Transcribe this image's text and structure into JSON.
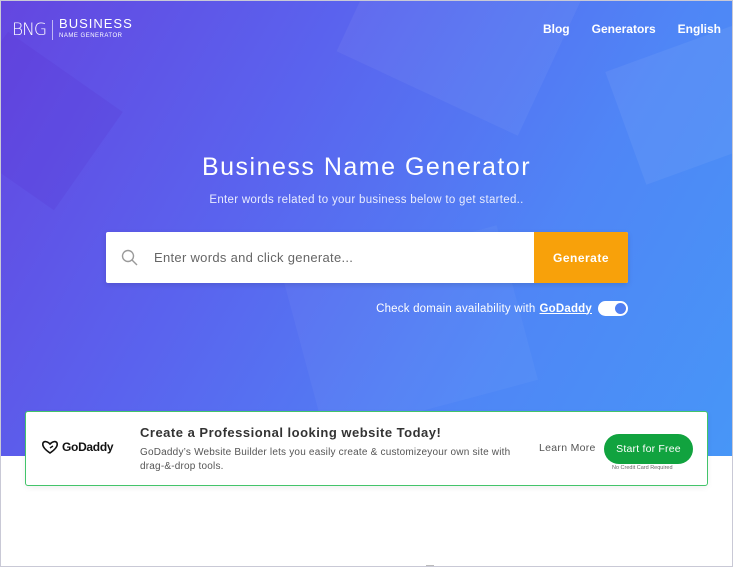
{
  "logo": {
    "mark": "BNG",
    "line1": "BUSINESS",
    "line2": "NAME GENERATOR"
  },
  "nav": {
    "blog": "Blog",
    "generators": "Generators",
    "language": "English"
  },
  "hero": {
    "title": "Business Name Generator",
    "subtitle": "Enter words related to your business below to get started.."
  },
  "search": {
    "placeholder": "Enter words and click generate...",
    "value": "",
    "button": "Generate"
  },
  "domain_check": {
    "text": "Check domain availability with",
    "link": "GoDaddy",
    "enabled": true
  },
  "ad": {
    "brand": "GoDaddy",
    "title": "Create a Professional looking website Today!",
    "description": "GoDaddy’s Website Builder lets you easily create & customizeyour own site with drag-&-drop tools.",
    "learn_more": "Learn More",
    "cta": "Start for Free",
    "note": "No Credit Card Required"
  },
  "colors": {
    "accent_orange": "#f8a10a",
    "cta_green": "#11a33f",
    "gradient_start": "#6446e0",
    "gradient_end": "#4796f7"
  }
}
